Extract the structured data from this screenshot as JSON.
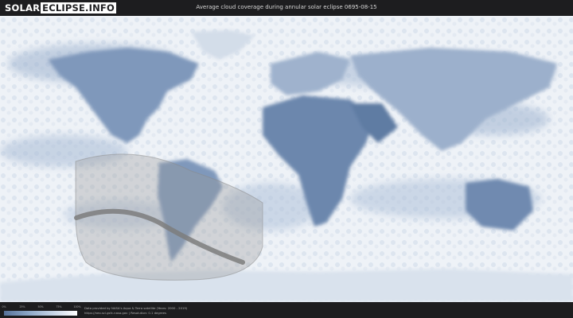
{
  "header": {
    "logo_part1": "SOLAR",
    "logo_part2": "ECLIPSE.INFO",
    "title": "Average cloud coverage during annular solar eclipse 0695-08-15"
  },
  "map": {
    "land_color": "#58729a",
    "clear_sky_color": "#58729a",
    "cloud_color": "#ffffff",
    "eclipse_path_color": "#8a8a8a",
    "visibility_zone_color": "#bdbdbd"
  },
  "legend": {
    "ticks": [
      "0%",
      "25%",
      "50%",
      "75%",
      "100%"
    ]
  },
  "footer": {
    "credit_line1": "Data provided by NASA's Aqua & Terra satellite (Years: 2000 - 2019)",
    "credit_line2": "https://neo.sci.gsfc.nasa.gov  |  Resolution: 0.1 degrees"
  }
}
